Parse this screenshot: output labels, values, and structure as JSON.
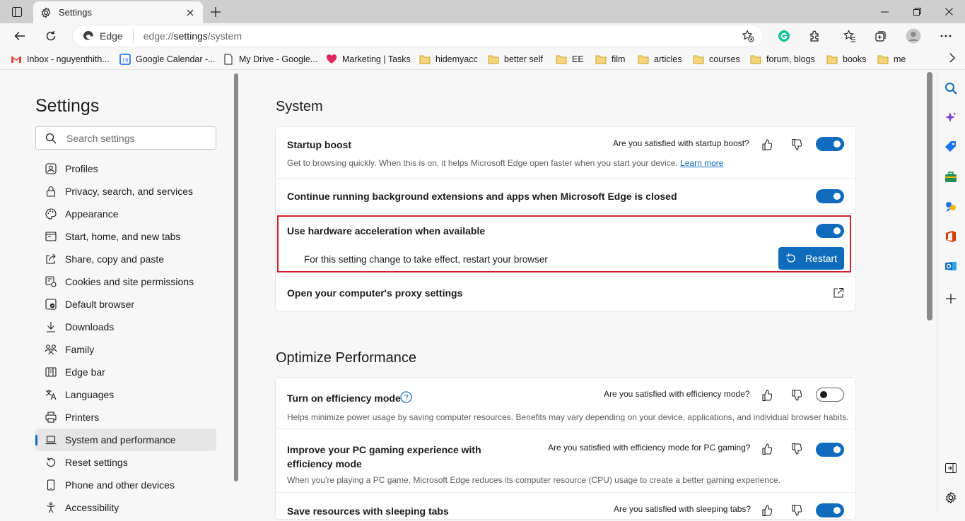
{
  "tab": {
    "title": "Settings"
  },
  "omnibox": {
    "site_label": "Edge",
    "url_prefix": "edge://",
    "url_main": "settings",
    "url_suffix": "/system"
  },
  "bookmarks": [
    {
      "label": "Inbox - nguyenthith...",
      "icon": "gmail-icon"
    },
    {
      "label": "Google Calendar -...",
      "icon": "calendar-icon"
    },
    {
      "label": "My Drive - Google...",
      "icon": "page-icon"
    },
    {
      "label": "Marketing | Tasks",
      "icon": "heart-icon"
    },
    {
      "label": "hidemyacc",
      "icon": "folder-icon"
    },
    {
      "label": "better self",
      "icon": "folder-icon"
    },
    {
      "label": "EE",
      "icon": "folder-icon"
    },
    {
      "label": "film",
      "icon": "folder-icon"
    },
    {
      "label": "articles",
      "icon": "folder-icon"
    },
    {
      "label": "courses",
      "icon": "folder-icon"
    },
    {
      "label": "forum, blogs",
      "icon": "folder-icon"
    },
    {
      "label": "books",
      "icon": "folder-icon"
    },
    {
      "label": "me",
      "icon": "folder-icon"
    }
  ],
  "nav": {
    "title": "Settings",
    "search_placeholder": "Search settings",
    "items": [
      {
        "label": "Profiles"
      },
      {
        "label": "Privacy, search, and services"
      },
      {
        "label": "Appearance"
      },
      {
        "label": "Start, home, and new tabs"
      },
      {
        "label": "Share, copy and paste"
      },
      {
        "label": "Cookies and site permissions"
      },
      {
        "label": "Default browser"
      },
      {
        "label": "Downloads"
      },
      {
        "label": "Family"
      },
      {
        "label": "Edge bar"
      },
      {
        "label": "Languages"
      },
      {
        "label": "Printers"
      },
      {
        "label": "System and performance"
      },
      {
        "label": "Reset settings"
      },
      {
        "label": "Phone and other devices"
      },
      {
        "label": "Accessibility"
      }
    ],
    "active_index": 12
  },
  "system": {
    "title": "System",
    "startup": {
      "title": "Startup boost",
      "feedback": "Are you satisfied with startup boost?",
      "desc": "Get to browsing quickly. When this is on, it helps Microsoft Edge open faster when you start your device.",
      "link": "Learn more",
      "enabled": true
    },
    "background": {
      "title": "Continue running background extensions and apps when Microsoft Edge is closed",
      "enabled": true
    },
    "hardware": {
      "title": "Use hardware acceleration when available",
      "restart_note": "For this setting change to take effect, restart your browser",
      "restart_label": "Restart",
      "enabled": true
    },
    "proxy": {
      "title": "Open your computer's proxy settings"
    }
  },
  "optimize": {
    "title": "Optimize Performance",
    "efficiency": {
      "title": "Turn on efficiency mode",
      "feedback": "Are you satisfied with efficiency mode?",
      "desc": "Helps minimize power usage by saving computer resources. Benefits may vary depending on your device, applications, and individual browser habits.",
      "enabled": false
    },
    "gaming": {
      "title": "Improve your PC gaming experience with efficiency mode",
      "feedback": "Are you satisfied with efficiency mode for PC gaming?",
      "desc": "When you're playing a PC game, Microsoft Edge reduces its computer resource (CPU) usage to create a better gaming experience.",
      "enabled": true
    },
    "sleeping": {
      "title": "Save resources with sleeping tabs",
      "feedback": "Are you satisfied with sleeping tabs?",
      "enabled": true
    }
  },
  "colors": {
    "accent": "#0f6cbd",
    "highlight": "#d21f2c"
  }
}
